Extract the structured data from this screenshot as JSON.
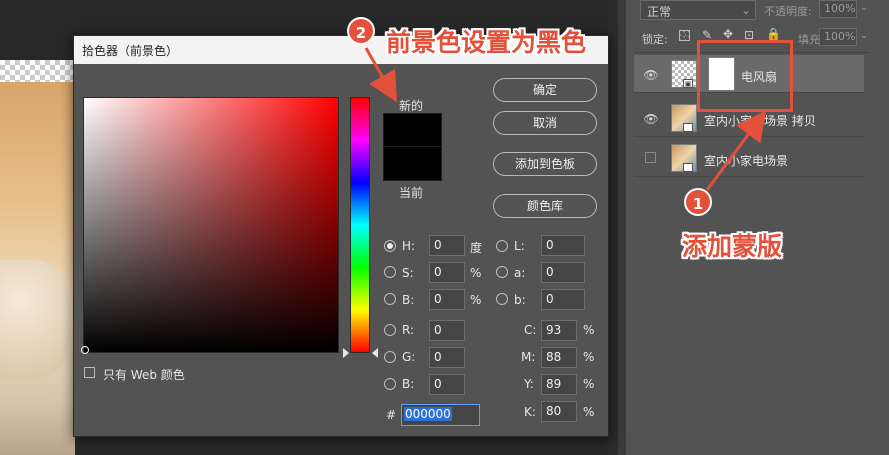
{
  "colors": {
    "accent": "#e4513a",
    "hex_selection": "#2d6fd6"
  },
  "layers_panel": {
    "blend_mode": "正常",
    "opacity_label": "不透明度:",
    "opacity_value": "100%",
    "lock_label": "锁定:",
    "fill_label": "填充:",
    "fill_value": "100%",
    "layers": [
      {
        "name": "电风扇",
        "visible": true
      },
      {
        "name": "室内小家电场景 拷贝",
        "visible": true
      },
      {
        "name": "室内小家电场景",
        "visible": false
      }
    ]
  },
  "dialog": {
    "title": "拾色器（前景色）",
    "new_label": "新的",
    "current_label": "当前",
    "buttons": {
      "ok": "确定",
      "cancel": "取消",
      "add_swatch": "添加到色板",
      "color_library": "颜色库"
    },
    "hsb": [
      {
        "label": "H:",
        "value": "0",
        "unit": "度"
      },
      {
        "label": "S:",
        "value": "0",
        "unit": "%"
      },
      {
        "label": "B:",
        "value": "0",
        "unit": "%"
      }
    ],
    "lab": [
      {
        "label": "L:",
        "value": "0"
      },
      {
        "label": "a:",
        "value": "0"
      },
      {
        "label": "b:",
        "value": "0"
      }
    ],
    "rgb": [
      {
        "label": "R:",
        "value": "0"
      },
      {
        "label": "G:",
        "value": "0"
      },
      {
        "label": "B:",
        "value": "0"
      }
    ],
    "cmyk": [
      {
        "label": "C:",
        "value": "93",
        "unit": "%"
      },
      {
        "label": "M:",
        "value": "88",
        "unit": "%"
      },
      {
        "label": "Y:",
        "value": "89",
        "unit": "%"
      },
      {
        "label": "K:",
        "value": "80",
        "unit": "%"
      }
    ],
    "hex_label": "#",
    "hex_value": "000000",
    "web_only_label": "只有 Web 颜色"
  },
  "annotations": {
    "step1_number": "1",
    "step1_text": "添加蒙版",
    "step2_number": "2",
    "step2_text": "前景色设置为黑色"
  }
}
